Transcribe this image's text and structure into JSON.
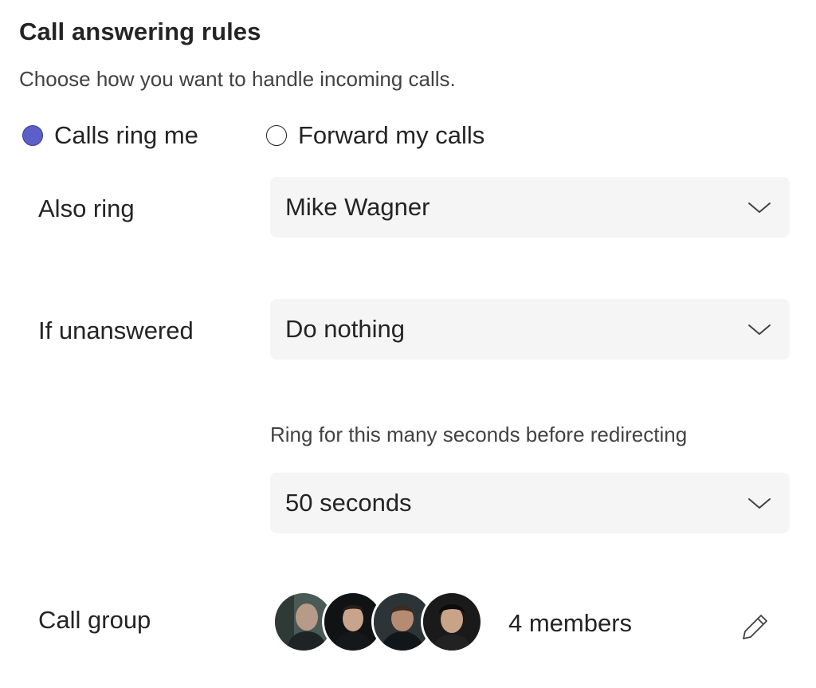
{
  "section": {
    "title": "Call answering rules",
    "subtitle": "Choose how you want to handle incoming calls."
  },
  "answer_mode": {
    "options": [
      {
        "label": "Calls ring me",
        "selected": true
      },
      {
        "label": "Forward my calls",
        "selected": false
      }
    ]
  },
  "also_ring": {
    "label": "Also ring",
    "value": "Mike Wagner",
    "icon": "chevron-down-icon"
  },
  "if_unanswered": {
    "label": "If unanswered",
    "value": "Do nothing",
    "icon": "chevron-down-icon"
  },
  "ring_duration": {
    "helper": "Ring for this many seconds before redirecting",
    "value": "50 seconds",
    "icon": "chevron-down-icon"
  },
  "call_group": {
    "label": "Call group",
    "members_text": "4 members",
    "avatar_count": 4,
    "edit_icon": "pencil-icon"
  },
  "colors": {
    "accent": "#5b5fc7",
    "dropdown_bg": "#f5f5f5",
    "text": "#242424",
    "secondary_text": "#424242"
  }
}
